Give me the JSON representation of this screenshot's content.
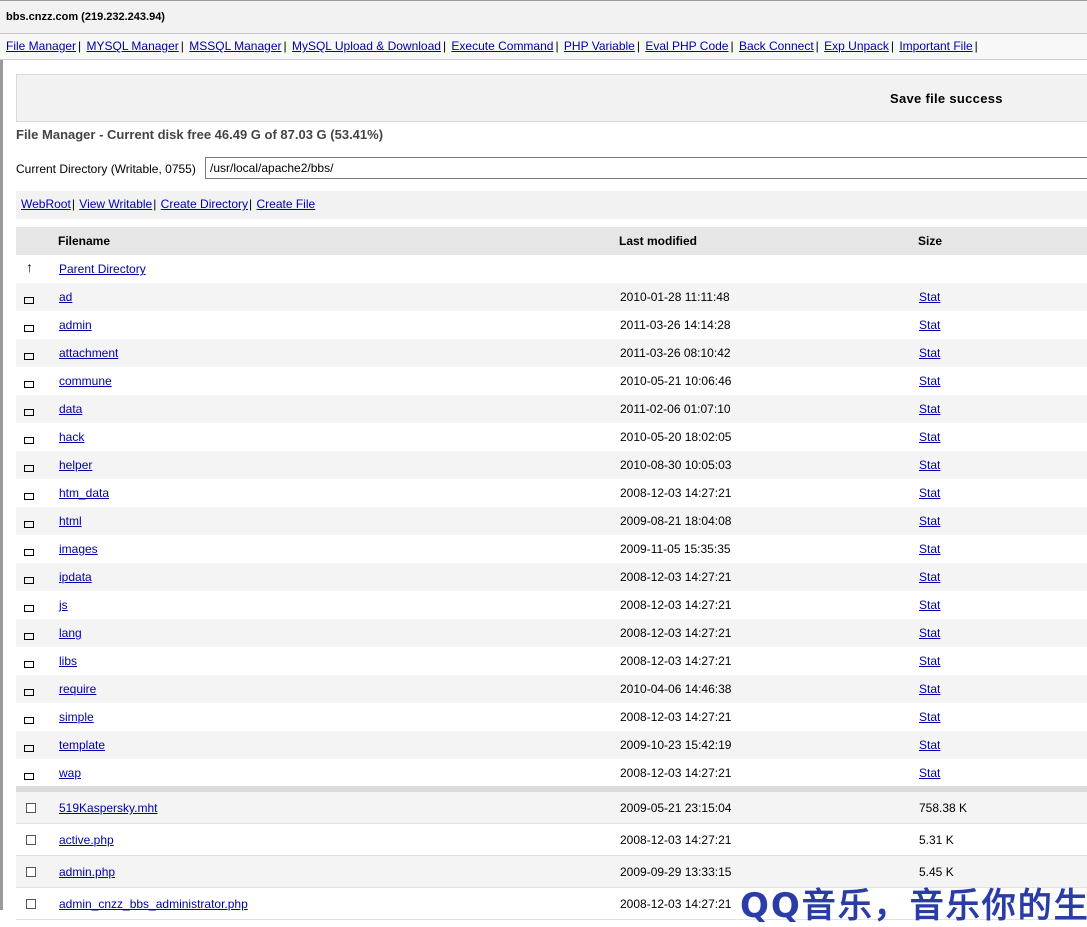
{
  "window": {
    "title": "bbs.cnzz.com (219.232.243.94)"
  },
  "nav": [
    "File Manager",
    "MYSQL Manager",
    "MSSQL Manager",
    "MySQL Upload & Download",
    "Execute Command",
    "PHP Variable",
    "Eval PHP Code",
    "Back Connect",
    "Exp Unpack",
    "Important File"
  ],
  "message": "Save file success",
  "disk_info": "File Manager - Current disk free 46.49 G of 87.03 G (53.41%)",
  "current_dir": {
    "label": "Current Directory (Writable, 0755)",
    "value": "/usr/local/apache2/bbs/"
  },
  "actions": [
    "WebRoot",
    "View Writable",
    "Create Directory",
    "Create File"
  ],
  "table": {
    "headers": {
      "filename": "Filename",
      "modified": "Last modified",
      "size": "Size"
    },
    "parent": {
      "label": "Parent Directory",
      "icon": "up-arrow-icon"
    },
    "dirs": [
      {
        "name": "ad",
        "date": "2010-01-28 11:11:48",
        "size": "Stat"
      },
      {
        "name": "admin",
        "date": "2011-03-26 14:14:28",
        "size": "Stat"
      },
      {
        "name": "attachment",
        "date": "2011-03-26 08:10:42",
        "size": "Stat"
      },
      {
        "name": "commune",
        "date": "2010-05-21 10:06:46",
        "size": "Stat"
      },
      {
        "name": "data",
        "date": "2011-02-06 01:07:10",
        "size": "Stat"
      },
      {
        "name": "hack",
        "date": "2010-05-20 18:02:05",
        "size": "Stat"
      },
      {
        "name": "helper",
        "date": "2010-08-30 10:05:03",
        "size": "Stat"
      },
      {
        "name": "htm_data",
        "date": "2008-12-03 14:27:21",
        "size": "Stat"
      },
      {
        "name": "html",
        "date": "2009-08-21 18:04:08",
        "size": "Stat"
      },
      {
        "name": "images",
        "date": "2009-11-05 15:35:35",
        "size": "Stat"
      },
      {
        "name": "ipdata",
        "date": "2008-12-03 14:27:21",
        "size": "Stat"
      },
      {
        "name": "js",
        "date": "2008-12-03 14:27:21",
        "size": "Stat"
      },
      {
        "name": "lang",
        "date": "2008-12-03 14:27:21",
        "size": "Stat"
      },
      {
        "name": "libs",
        "date": "2008-12-03 14:27:21",
        "size": "Stat"
      },
      {
        "name": "require",
        "date": "2010-04-06 14:46:38",
        "size": "Stat"
      },
      {
        "name": "simple",
        "date": "2008-12-03 14:27:21",
        "size": "Stat"
      },
      {
        "name": "template",
        "date": "2009-10-23 15:42:19",
        "size": "Stat"
      },
      {
        "name": "wap",
        "date": "2008-12-03 14:27:21",
        "size": "Stat"
      }
    ],
    "files": [
      {
        "name": "519Kaspersky.mht",
        "date": "2009-05-21 23:15:04",
        "size": "758.38 K"
      },
      {
        "name": "active.php",
        "date": "2008-12-03 14:27:21",
        "size": "5.31 K"
      },
      {
        "name": "admin.php",
        "date": "2009-09-29 13:33:15",
        "size": "5.45 K"
      },
      {
        "name": "admin_cnzz_bbs_administrator.php",
        "date": "2008-12-03 14:27:21",
        "size": ""
      }
    ]
  },
  "overlay_text": "QQ音乐，音乐你的生活"
}
